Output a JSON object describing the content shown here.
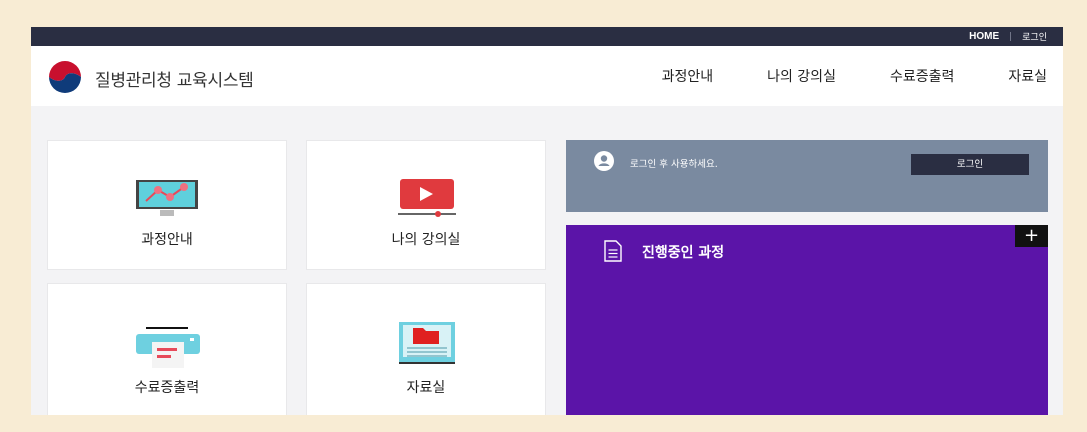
{
  "topbar": {
    "home": "HOME",
    "separator": "|",
    "login": "로그인"
  },
  "header": {
    "brand": "질병관리청 교육시스템",
    "nav": [
      "과정안내",
      "나의 강의실",
      "수료증출력",
      "자료실"
    ]
  },
  "cards": [
    {
      "label": "과정안내",
      "icon": "monitor-chart-icon"
    },
    {
      "label": "나의 강의실",
      "icon": "video-player-icon"
    },
    {
      "label": "수료증출력",
      "icon": "printer-icon"
    },
    {
      "label": "자료실",
      "icon": "folder-document-icon"
    }
  ],
  "login_box": {
    "message": "로그인 후 사용하세요.",
    "button": "로그인"
  },
  "in_progress": {
    "title": "진행중인 과정",
    "more": "+"
  },
  "colors": {
    "topbar": "#2a2e42",
    "login_box": "#7a8aa0",
    "in_progress": "#5b14a8",
    "background": "#f8ecd4"
  }
}
